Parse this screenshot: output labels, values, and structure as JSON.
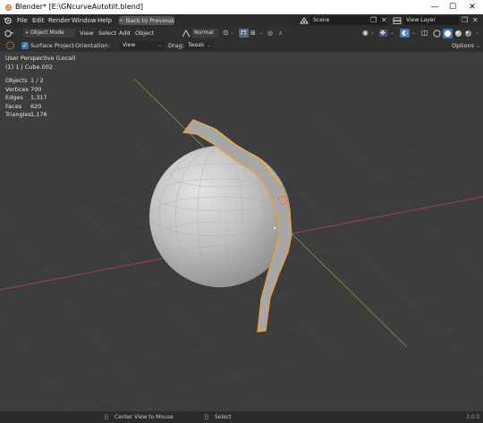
{
  "window": {
    "title": "Blender* [E:\\GNcurveAutotilt.blend]",
    "minimize": "—",
    "maximize": "☐",
    "close": "✕"
  },
  "menu": {
    "items": [
      "File",
      "Edit",
      "Render",
      "Window",
      "Help"
    ],
    "workspace_button": "Back to Previous",
    "scene_label": "Scene",
    "view_layer_label": "View Layer"
  },
  "toolbar": {
    "mode": "Object Mode",
    "menus": [
      "View",
      "Select",
      "Add",
      "Object"
    ],
    "transform_orientation": "Normal"
  },
  "tool_header": {
    "surface_project_label": "Surface Project",
    "surface_project_checked": true,
    "orientation_label": "Orientation:",
    "orientation_value": "View",
    "drag_label": "Drag:",
    "drag_value": "Tweak",
    "options_label": "Options"
  },
  "viewport": {
    "perspective": "User Perspective (Local)",
    "object_info": "(1) 1 | Cube.002",
    "stats": [
      {
        "label": "Objects",
        "value": "1 / 2"
      },
      {
        "label": "Vertices",
        "value": "700"
      },
      {
        "label": "Edges",
        "value": "1,317"
      },
      {
        "label": "Faces",
        "value": "620"
      },
      {
        "label": "Triangles",
        "value": "1,176"
      }
    ]
  },
  "statusbar": {
    "left_hint": "Center View to Mouse",
    "right_hint": "Select",
    "version": "3.0.0"
  },
  "colors": {
    "accent": "#4772b3",
    "selection_orange": "#f0a030",
    "x_axis": "#b3414d",
    "y_axis": "#7d9b2e"
  }
}
